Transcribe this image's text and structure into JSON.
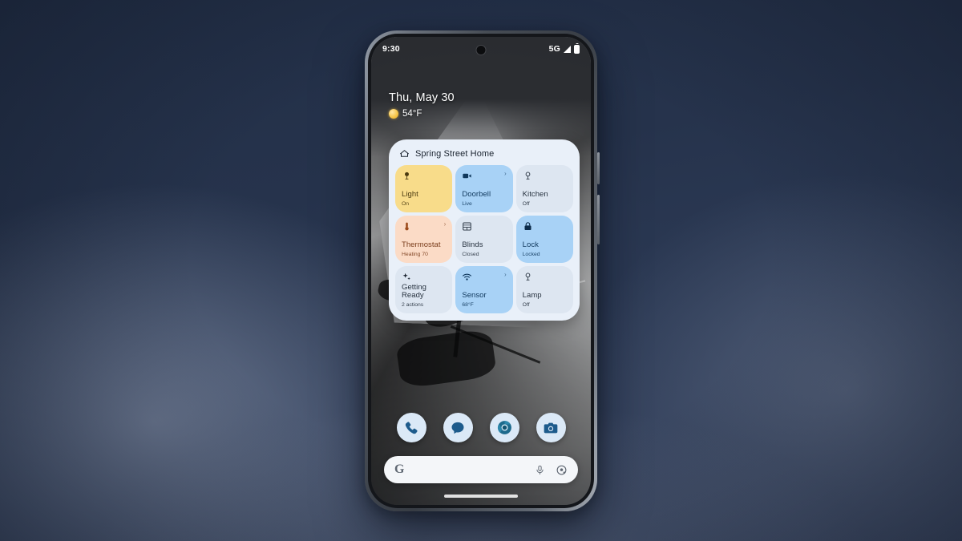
{
  "phone": {
    "status_bar": {
      "time": "9:30",
      "network": "5G",
      "signal_icon": "signal-triangle-icon",
      "battery_icon": "battery-full-icon",
      "camera_icon": "front-camera-punch-hole"
    },
    "at_a_glance": {
      "date": "Thu, May 30",
      "weather_icon": "sun-icon",
      "temperature": "54°F"
    },
    "home_widget": {
      "home_icon": "home-outline-icon",
      "title": "Spring Street Home",
      "card_color": "#e9f0f9",
      "tiles": [
        {
          "name": "light",
          "icon": "light-bulb-icon",
          "label": "Light",
          "status": "On",
          "state": "active",
          "bg": "#f8dc8a",
          "fg": "#4a3a10",
          "chevron": false
        },
        {
          "name": "doorbell",
          "icon": "video-camera-icon",
          "label": "Doorbell",
          "status": "Live",
          "state": "active",
          "bg": "#a8d2f6",
          "fg": "#10385c",
          "chevron": true
        },
        {
          "name": "kitchen",
          "icon": "light-bulb-icon",
          "label": "Kitchen",
          "status": "Off",
          "state": "inactive",
          "bg": "#dde6f1",
          "fg": "#283340",
          "chevron": false
        },
        {
          "name": "thermostat",
          "icon": "thermometer-icon",
          "label": "Thermostat",
          "status": "Heating 70",
          "state": "heating",
          "bg": "#fbdbc6",
          "fg": "#7a3d1c",
          "chevron": true
        },
        {
          "name": "blinds",
          "icon": "blinds-icon",
          "label": "Blinds",
          "status": "Closed",
          "state": "inactive",
          "bg": "#dde6f1",
          "fg": "#283340",
          "chevron": false
        },
        {
          "name": "lock",
          "icon": "lock-closed-icon",
          "label": "Lock",
          "status": "Locked",
          "state": "active",
          "bg": "#a8d2f6",
          "fg": "#10385c",
          "chevron": false
        },
        {
          "name": "getting-ready",
          "icon": "sparkles-icon",
          "label": "Getting Ready",
          "status": "2 actions",
          "state": "inactive",
          "bg": "#dde6f1",
          "fg": "#283340",
          "chevron": false
        },
        {
          "name": "sensor",
          "icon": "wifi-sensor-icon",
          "label": "Sensor",
          "status": "68°F",
          "state": "active",
          "bg": "#a8d2f6",
          "fg": "#10385c",
          "chevron": true
        },
        {
          "name": "lamp",
          "icon": "light-bulb-icon",
          "label": "Lamp",
          "status": "Off",
          "state": "inactive",
          "bg": "#dde6f1",
          "fg": "#283340",
          "chevron": false
        }
      ]
    },
    "dock": {
      "apps": [
        {
          "name": "phone",
          "icon": "phone-handset-icon",
          "label": "Phone"
        },
        {
          "name": "messages",
          "icon": "chat-bubble-icon",
          "label": "Messages"
        },
        {
          "name": "chrome",
          "icon": "chrome-browser-icon",
          "label": "Chrome"
        },
        {
          "name": "camera",
          "icon": "camera-icon",
          "label": "Camera"
        }
      ]
    },
    "search_bar": {
      "logo": "G",
      "logo_icon": "google-g-icon",
      "placeholder": "",
      "mic_icon": "microphone-icon",
      "lens_icon": "google-lens-icon"
    },
    "nav_pill": "home-gesture-pill"
  },
  "colors": {
    "backdrop_dark": "#233049",
    "backdrop_light": "#59637a",
    "tile_active_blue": "#a8d2f6",
    "tile_inactive": "#dde6f1",
    "tile_yellow": "#f8dc8a",
    "tile_peach": "#fbdbc6",
    "widget_card": "#e9f0f9"
  }
}
